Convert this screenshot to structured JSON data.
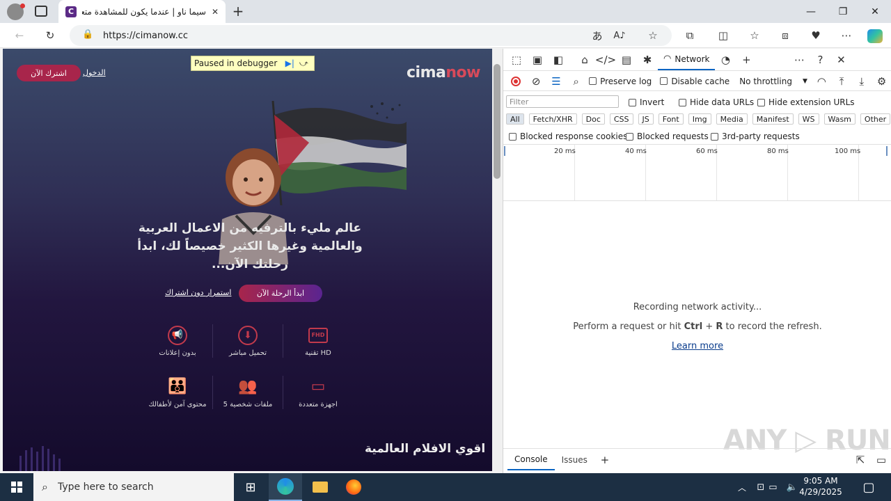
{
  "browser": {
    "tab_title": "سيما ناو | عندما يكون للمشاهدة متعة",
    "tab_close": "✕",
    "new_tab": "+",
    "url": "https://cimanow.cc"
  },
  "site": {
    "subscribe_label": "اشترك الآن",
    "login_label": "الدخول",
    "logo_part1": "cima",
    "logo_part2": "now",
    "paused_label": "Paused in debugger",
    "hero_text": "عالم مليء بالترفيه من الاعمال العربية والعالمية وغيرها الكثير خصيصاً لك، ابدأ رحلتك الآن...",
    "start_label": "ابدأ الرحلة الآن",
    "no_sub_label": "استمرار دون اشتراك",
    "features_row1": [
      {
        "icon": "fhd-icon",
        "label": "تقنية HD",
        "glyph": "FHD"
      },
      {
        "icon": "download-icon",
        "label": "تحميل مباشر",
        "glyph": "⬇"
      },
      {
        "icon": "no-ads-icon",
        "label": "بدون إعلانات",
        "glyph": "📢"
      }
    ],
    "features_row2": [
      {
        "icon": "devices-icon",
        "label": "اجهزة متعددة",
        "glyph": "▭"
      },
      {
        "icon": "profiles-icon",
        "label": "5 ملفات شخصية",
        "glyph": "👥"
      },
      {
        "icon": "kids-icon",
        "label": "محتوى آمن لأطفالك",
        "glyph": "👪"
      }
    ],
    "strong_label": "اقوي الافلام العالمية"
  },
  "devtools": {
    "network_tab": "Network",
    "preserve_log": "Preserve log",
    "disable_cache": "Disable cache",
    "throttling": "No throttling",
    "filter_placeholder": "Filter",
    "invert": "Invert",
    "hide_data_urls": "Hide data URLs",
    "hide_extension_urls": "Hide extension URLs",
    "chips": [
      "All",
      "Fetch/XHR",
      "Doc",
      "CSS",
      "JS",
      "Font",
      "Img",
      "Media",
      "Manifest",
      "WS",
      "Wasm",
      "Other"
    ],
    "blocked_cookies": "Blocked response cookies",
    "blocked_requests": "Blocked requests",
    "third_party": "3rd-party requests",
    "timeline_labels": [
      "20 ms",
      "40 ms",
      "60 ms",
      "80 ms",
      "100 ms"
    ],
    "recording": "Recording network activity...",
    "perform_pre": "Perform a request or hit ",
    "ctrl": "Ctrl",
    "plus": " + ",
    "r": "R",
    "perform_post": " to record the refresh.",
    "learn_more": "Learn more",
    "console_tab": "Console",
    "issues_tab": "Issues"
  },
  "watermark": "ANY ▷ RUN",
  "taskbar": {
    "search_placeholder": "Type here to search",
    "time": "9:05 AM",
    "date": "4/29/2025"
  }
}
